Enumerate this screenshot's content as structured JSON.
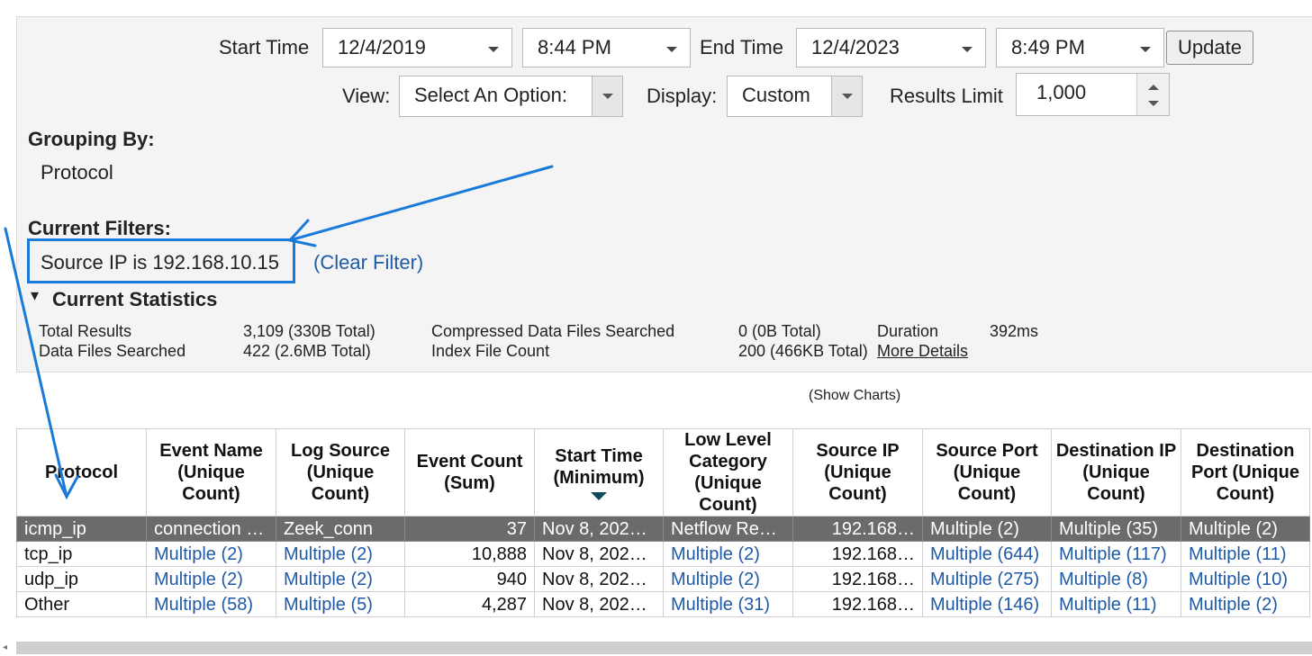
{
  "toolbar": {
    "start_time_label": "Start Time",
    "start_date": "12/4/2019",
    "start_time": "8:44 PM",
    "end_time_label": "End Time",
    "end_date": "12/4/2023",
    "end_time": "8:49 PM",
    "update_label": "Update",
    "view_label": "View:",
    "view_value": "Select An Option:",
    "display_label": "Display:",
    "display_value": "Custom",
    "results_limit_label": "Results Limit",
    "results_limit_value": "1,000"
  },
  "grouping": {
    "heading": "Grouping By:",
    "value": "Protocol"
  },
  "filters": {
    "heading": "Current Filters:",
    "filter_text": "Source IP is 192.168.10.15",
    "clear_label": "(Clear Filter)"
  },
  "statistics": {
    "toggle_glyph": "▾",
    "heading": "Current Statistics",
    "total_results_label": "Total Results",
    "total_results_value": "3,109 (330B Total)",
    "data_files_label": "Data Files Searched",
    "data_files_value": "422 (2.6MB Total)",
    "compressed_label": "Compressed Data Files Searched",
    "compressed_value": "0 (0B Total)",
    "index_label": "Index File Count",
    "index_value": "200 (466KB Total)",
    "duration_label": "Duration",
    "duration_value": "392ms",
    "more_details_label": "More Details"
  },
  "show_charts_label": "(Show Charts)",
  "table": {
    "columns": [
      "Protocol",
      "Event Name (Unique Count)",
      "Log Source (Unique Count)",
      "Event Count (Sum)",
      "Start Time (Minimum)",
      "Low Level Category (Unique Count)",
      "Source IP (Unique Count)",
      "Source Port (Unique Count)",
      "Destination IP (Unique Count)",
      "Destination Port (Unique Count)"
    ],
    "rows": [
      [
        "icmp_ip",
        "connection …",
        "Zeek_conn",
        "37",
        "Nov 8, 202…",
        "Netflow Re…",
        "192.168…",
        "Multiple (2)",
        "Multiple (35)",
        "Multiple (2)"
      ],
      [
        "tcp_ip",
        "Multiple (2)",
        "Multiple (2)",
        "10,888",
        "Nov 8, 202…",
        "Multiple (2)",
        "192.168…",
        "Multiple (644)",
        "Multiple (117)",
        "Multiple (11)"
      ],
      [
        "udp_ip",
        "Multiple (2)",
        "Multiple (2)",
        "940",
        "Nov 8, 202…",
        "Multiple (2)",
        "192.168…",
        "Multiple (275)",
        "Multiple (8)",
        "Multiple (10)"
      ],
      [
        "Other",
        "Multiple (58)",
        "Multiple (5)",
        "4,287",
        "Nov 8, 202…",
        "Multiple (31)",
        "192.168…",
        "Multiple (146)",
        "Multiple (11)",
        "Multiple (2)"
      ]
    ]
  },
  "colors": {
    "annotation": "#1a7ad9",
    "link": "#1f5aa6",
    "selected_row": "#6b6b6b"
  }
}
